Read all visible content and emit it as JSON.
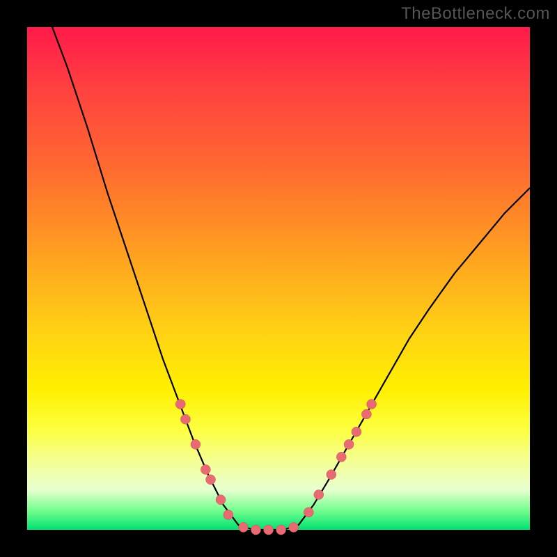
{
  "watermark": "TheBottleneck.com",
  "colors": {
    "curve_stroke": "#000000",
    "marker_fill": "#e86a72",
    "marker_stroke": "#d0505a"
  },
  "chart_data": {
    "type": "line",
    "title": "",
    "xlabel": "",
    "ylabel": "",
    "xlim": [
      0,
      100
    ],
    "ylim": [
      0,
      100
    ],
    "curve": [
      {
        "x": 5,
        "y": 100
      },
      {
        "x": 8,
        "y": 92
      },
      {
        "x": 12,
        "y": 80
      },
      {
        "x": 16,
        "y": 67
      },
      {
        "x": 20,
        "y": 55
      },
      {
        "x": 24,
        "y": 43
      },
      {
        "x": 27,
        "y": 34
      },
      {
        "x": 30,
        "y": 26
      },
      {
        "x": 33,
        "y": 18
      },
      {
        "x": 36,
        "y": 11
      },
      {
        "x": 39,
        "y": 5
      },
      {
        "x": 42,
        "y": 1
      },
      {
        "x": 45,
        "y": 0
      },
      {
        "x": 48,
        "y": 0
      },
      {
        "x": 51,
        "y": 0
      },
      {
        "x": 54,
        "y": 1
      },
      {
        "x": 57,
        "y": 5
      },
      {
        "x": 60,
        "y": 10
      },
      {
        "x": 64,
        "y": 17
      },
      {
        "x": 68,
        "y": 24
      },
      {
        "x": 72,
        "y": 31
      },
      {
        "x": 76,
        "y": 38
      },
      {
        "x": 80,
        "y": 44
      },
      {
        "x": 85,
        "y": 51
      },
      {
        "x": 90,
        "y": 57
      },
      {
        "x": 95,
        "y": 63
      },
      {
        "x": 100,
        "y": 68
      }
    ],
    "markers": [
      {
        "x": 30.5,
        "y": 25
      },
      {
        "x": 31.5,
        "y": 22
      },
      {
        "x": 33.5,
        "y": 17
      },
      {
        "x": 35.5,
        "y": 12
      },
      {
        "x": 36.5,
        "y": 10
      },
      {
        "x": 38.5,
        "y": 6
      },
      {
        "x": 40.0,
        "y": 3
      },
      {
        "x": 43.0,
        "y": 0.5
      },
      {
        "x": 45.5,
        "y": 0
      },
      {
        "x": 48.0,
        "y": 0
      },
      {
        "x": 50.5,
        "y": 0
      },
      {
        "x": 53.0,
        "y": 0.5
      },
      {
        "x": 56.0,
        "y": 3.5
      },
      {
        "x": 58.0,
        "y": 7
      },
      {
        "x": 60.5,
        "y": 11
      },
      {
        "x": 62.5,
        "y": 14.5
      },
      {
        "x": 64.0,
        "y": 17
      },
      {
        "x": 65.5,
        "y": 19.5
      },
      {
        "x": 67.5,
        "y": 23
      },
      {
        "x": 68.5,
        "y": 25
      }
    ]
  }
}
